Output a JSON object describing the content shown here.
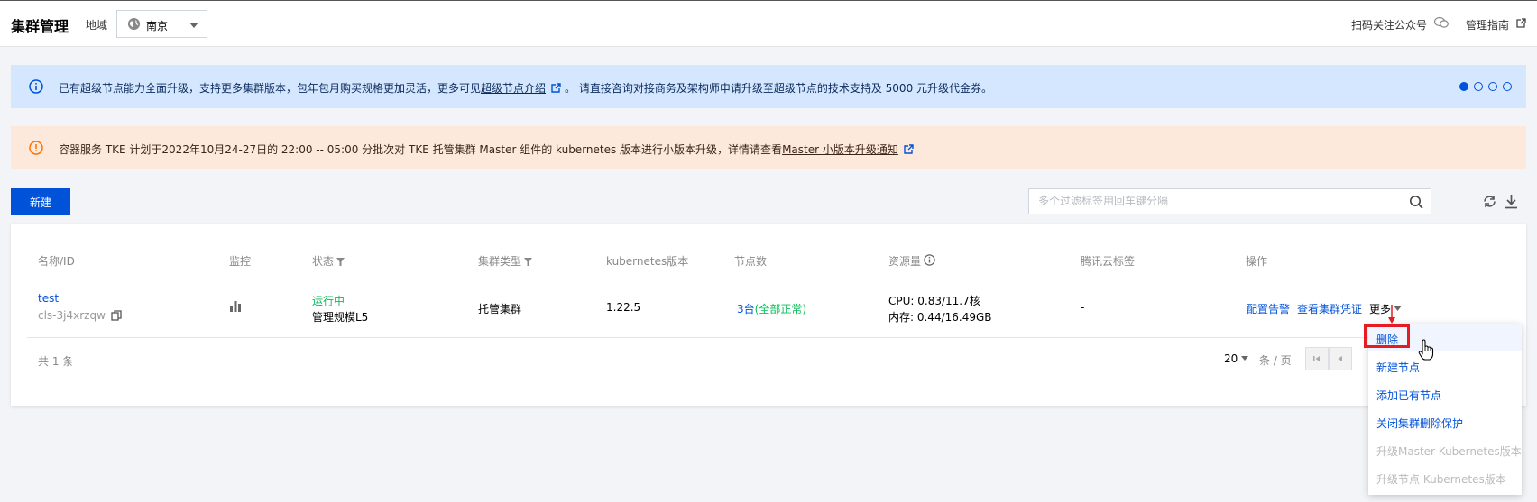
{
  "header": {
    "title": "集群管理",
    "region_label": "地域",
    "region_value": "南京",
    "qr_follow": "扫码关注公众号",
    "guide": "管理指南"
  },
  "banners": {
    "info": {
      "text_before": "已有超级节点能力全面升级，支持更多集群版本，包年包月购买规格更加灵活，更多可见",
      "link": "超级节点介绍",
      "text_after": "。 请直接咨询对接商务及架构师申请升级至超级节点的技术支持及 5000 元升级代金券。",
      "dots": 4
    },
    "warning": {
      "text_before": "容器服务 TKE 计划于2022年10月24-27日的 22:00 -- 05:00 分批次对 TKE 托管集群 Master 组件的 kubernetes 版本进行小版本升级，详情请查看",
      "link": "Master 小版本升级通知"
    }
  },
  "toolbar": {
    "new_button": "新建",
    "search_placeholder": "多个过滤标签用回车键分隔"
  },
  "table": {
    "headers": {
      "name": "名称/ID",
      "monitor": "监控",
      "status": "状态",
      "type": "集群类型",
      "version": "kubernetes版本",
      "nodes": "节点数",
      "resources": "资源量",
      "tags": "腾讯云标签",
      "actions": "操作"
    },
    "rows": [
      {
        "name": "test",
        "id": "cls-3j4xrzqw",
        "status": "运行中",
        "scale": "管理规模L5",
        "type": "托管集群",
        "version": "1.22.5",
        "nodes_count": "3台",
        "nodes_status": "(全部正常)",
        "cpu": "CPU: 0.83/11.7核",
        "mem": "内存: 0.44/16.49GB",
        "tags": "-",
        "action_alarm": "配置告警",
        "action_cred": "查看集群凭证",
        "action_more": "更多"
      }
    ]
  },
  "pagination": {
    "total": "共 1 条",
    "page_size": "20",
    "unit": "条 / 页"
  },
  "more_menu": {
    "items": [
      {
        "label": "删除",
        "enabled": true
      },
      {
        "label": "新建节点",
        "enabled": true
      },
      {
        "label": "添加已有节点",
        "enabled": true
      },
      {
        "label": "关闭集群删除保护",
        "enabled": true
      },
      {
        "label": "升级Master Kubernetes版本",
        "enabled": false
      },
      {
        "label": "升级节点 Kubernetes版本",
        "enabled": false
      }
    ]
  },
  "colors": {
    "primary": "#0052d9",
    "success": "#0abf5b",
    "info_bg": "#d5e7ff",
    "warn_bg": "#fde9dc",
    "highlight": "#e51c23"
  }
}
